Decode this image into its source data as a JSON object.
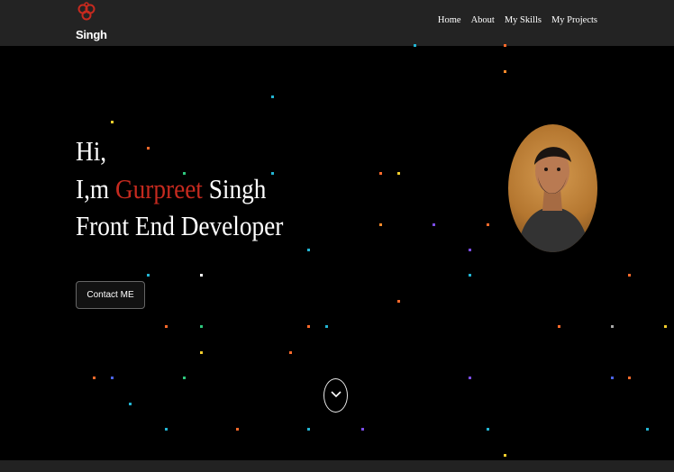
{
  "brand": {
    "logo_text": "Singh",
    "logo_icon": "triple-knot-logo",
    "accent_color": "#c62a1f"
  },
  "nav": {
    "items": [
      "Home",
      "About",
      "My Skills",
      "My Projects"
    ]
  },
  "hero": {
    "greeting": "Hi,",
    "intro_prefix": "I,m ",
    "first_name": "Gurpreet",
    "last_name": " Singh",
    "role": "Front End Developer",
    "cta_label": "Contact ME",
    "profile_photo": "profile-photo",
    "scroll_icon": "chevron-down-icon"
  },
  "colors": {
    "background": "#000000",
    "header": "#232323",
    "text": "#ffffff"
  }
}
